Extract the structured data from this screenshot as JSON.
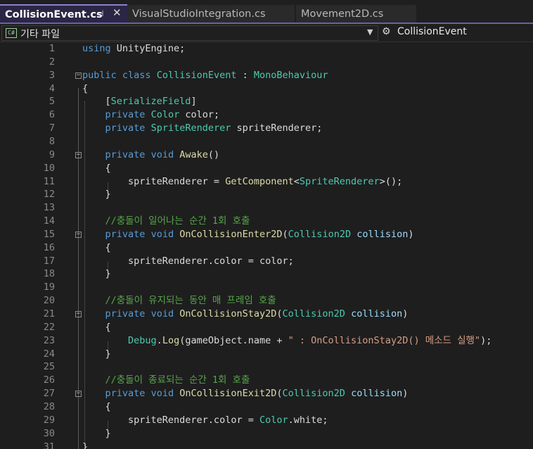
{
  "tabs": [
    {
      "label": "CollisionEvent.cs",
      "active": true,
      "pin_icon": "pin-icon",
      "close_icon": "close-icon"
    },
    {
      "label": "VisualStudioIntegration.cs",
      "active": false
    },
    {
      "label": "Movement2D.cs",
      "active": false
    }
  ],
  "nav": {
    "project_badge": "C#",
    "project_label": "기타 파일",
    "member_label": "CollisionEvent",
    "member_icon": "class-member-icon"
  },
  "colors": {
    "keyword": "#569cd6",
    "type": "#4ec9b0",
    "method": "#dcdcaa",
    "comment": "#57a64a",
    "string": "#d69d85",
    "parameter": "#9cdcfe",
    "plain": "#dcdcdc",
    "active_tab_accent": "#6b5fa8"
  },
  "code_lines": [
    {
      "num": "1",
      "fold": "",
      "tokens": [
        [
          "kw",
          "using"
        ],
        [
          "pl",
          " UnityEngine;"
        ]
      ]
    },
    {
      "num": "2",
      "fold": "",
      "tokens": []
    },
    {
      "num": "3",
      "fold": "−",
      "tokens": [
        [
          "kw",
          "public"
        ],
        [
          "pl",
          " "
        ],
        [
          "kw",
          "class"
        ],
        [
          "pl",
          " "
        ],
        [
          "ty",
          "CollisionEvent"
        ],
        [
          "pl",
          " : "
        ],
        [
          "ty",
          "MonoBehaviour"
        ]
      ]
    },
    {
      "num": "4",
      "fold": "",
      "tokens": [
        [
          "pl",
          "{"
        ]
      ]
    },
    {
      "num": "5",
      "fold": "",
      "tokens": [
        [
          "pl",
          "    ["
        ],
        [
          "ty",
          "SerializeField"
        ],
        [
          "pl",
          "]"
        ]
      ]
    },
    {
      "num": "6",
      "fold": "",
      "tokens": [
        [
          "pl",
          "    "
        ],
        [
          "kw",
          "private"
        ],
        [
          "pl",
          " "
        ],
        [
          "ty",
          "Color"
        ],
        [
          "pl",
          " color;"
        ]
      ]
    },
    {
      "num": "7",
      "fold": "",
      "tokens": [
        [
          "pl",
          "    "
        ],
        [
          "kw",
          "private"
        ],
        [
          "pl",
          " "
        ],
        [
          "ty",
          "SpriteRenderer"
        ],
        [
          "pl",
          " spriteRenderer;"
        ]
      ]
    },
    {
      "num": "8",
      "fold": "",
      "tokens": []
    },
    {
      "num": "9",
      "fold": "−",
      "tokens": [
        [
          "pl",
          "    "
        ],
        [
          "kw",
          "private"
        ],
        [
          "pl",
          " "
        ],
        [
          "kw",
          "void"
        ],
        [
          "pl",
          " "
        ],
        [
          "fn",
          "Awake"
        ],
        [
          "pl",
          "()"
        ]
      ]
    },
    {
      "num": "10",
      "fold": "",
      "tokens": [
        [
          "pl",
          "    {"
        ]
      ]
    },
    {
      "num": "11",
      "fold": "",
      "tokens": [
        [
          "pl",
          "        spriteRenderer = "
        ],
        [
          "fn",
          "GetComponent"
        ],
        [
          "pl",
          "<"
        ],
        [
          "ty",
          "SpriteRenderer"
        ],
        [
          "pl",
          ">();"
        ]
      ]
    },
    {
      "num": "12",
      "fold": "",
      "tokens": [
        [
          "pl",
          "    }"
        ]
      ]
    },
    {
      "num": "13",
      "fold": "",
      "tokens": []
    },
    {
      "num": "14",
      "fold": "",
      "tokens": [
        [
          "pl",
          "    "
        ],
        [
          "cm",
          "//충돌이 일어나는 순간 1회 호출"
        ]
      ]
    },
    {
      "num": "15",
      "fold": "−",
      "tokens": [
        [
          "pl",
          "    "
        ],
        [
          "kw",
          "private"
        ],
        [
          "pl",
          " "
        ],
        [
          "kw",
          "void"
        ],
        [
          "pl",
          " "
        ],
        [
          "fn",
          "OnCollisionEnter2D"
        ],
        [
          "pl",
          "("
        ],
        [
          "ty",
          "Collision2D"
        ],
        [
          "pl",
          " "
        ],
        [
          "prm",
          "collision"
        ],
        [
          "pl",
          ")"
        ]
      ]
    },
    {
      "num": "16",
      "fold": "",
      "tokens": [
        [
          "pl",
          "    {"
        ]
      ]
    },
    {
      "num": "17",
      "fold": "",
      "tokens": [
        [
          "pl",
          "        spriteRenderer.color = color;"
        ]
      ]
    },
    {
      "num": "18",
      "fold": "",
      "tokens": [
        [
          "pl",
          "    }"
        ]
      ]
    },
    {
      "num": "19",
      "fold": "",
      "tokens": []
    },
    {
      "num": "20",
      "fold": "",
      "tokens": [
        [
          "pl",
          "    "
        ],
        [
          "cm",
          "//충돌이 유지되는 동안 매 프레임 호출"
        ]
      ]
    },
    {
      "num": "21",
      "fold": "−",
      "tokens": [
        [
          "pl",
          "    "
        ],
        [
          "kw",
          "private"
        ],
        [
          "pl",
          " "
        ],
        [
          "kw",
          "void"
        ],
        [
          "pl",
          " "
        ],
        [
          "fn",
          "OnCollisionStay2D"
        ],
        [
          "pl",
          "("
        ],
        [
          "ty",
          "Collision2D"
        ],
        [
          "pl",
          " "
        ],
        [
          "prm",
          "collision"
        ],
        [
          "pl",
          ")"
        ]
      ]
    },
    {
      "num": "22",
      "fold": "",
      "tokens": [
        [
          "pl",
          "    {"
        ]
      ]
    },
    {
      "num": "23",
      "fold": "",
      "tokens": [
        [
          "pl",
          "        "
        ],
        [
          "ty",
          "Debug"
        ],
        [
          "pl",
          "."
        ],
        [
          "fn",
          "Log"
        ],
        [
          "pl",
          "(gameObject.name + "
        ],
        [
          "str",
          "\" : OnCollisionStay2D() 메소드 실행\""
        ],
        [
          "pl",
          ");"
        ]
      ]
    },
    {
      "num": "24",
      "fold": "",
      "tokens": [
        [
          "pl",
          "    }"
        ]
      ]
    },
    {
      "num": "25",
      "fold": "",
      "tokens": []
    },
    {
      "num": "26",
      "fold": "",
      "tokens": [
        [
          "pl",
          "    "
        ],
        [
          "cm",
          "//충돌이 종료되는 순간 1회 호출"
        ]
      ]
    },
    {
      "num": "27",
      "fold": "−",
      "tokens": [
        [
          "pl",
          "    "
        ],
        [
          "kw",
          "private"
        ],
        [
          "pl",
          " "
        ],
        [
          "kw",
          "void"
        ],
        [
          "pl",
          " "
        ],
        [
          "fn",
          "OnCollisionExit2D"
        ],
        [
          "pl",
          "("
        ],
        [
          "ty",
          "Collision2D"
        ],
        [
          "pl",
          " "
        ],
        [
          "prm",
          "collision"
        ],
        [
          "pl",
          ")"
        ]
      ]
    },
    {
      "num": "28",
      "fold": "",
      "tokens": [
        [
          "pl",
          "    {"
        ]
      ]
    },
    {
      "num": "29",
      "fold": "",
      "tokens": [
        [
          "pl",
          "        spriteRenderer.color = "
        ],
        [
          "ty",
          "Color"
        ],
        [
          "pl",
          ".white;"
        ]
      ]
    },
    {
      "num": "30",
      "fold": "",
      "tokens": [
        [
          "pl",
          "    }"
        ]
      ]
    },
    {
      "num": "31",
      "fold": "",
      "tokens": [
        [
          "pl",
          "}"
        ]
      ]
    }
  ]
}
